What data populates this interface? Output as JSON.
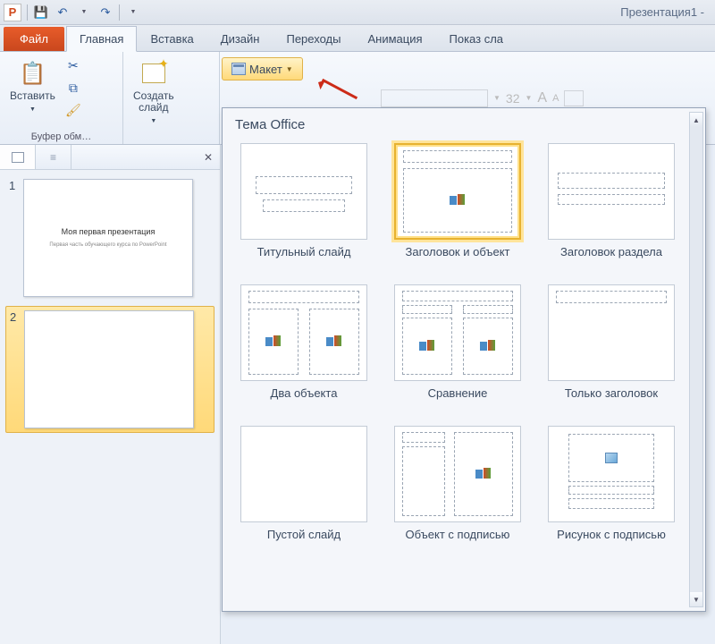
{
  "titlebar": {
    "app_letter": "P",
    "doc_title": "Презентация1 -"
  },
  "qat": {
    "save": "💾",
    "undo": "↶",
    "redo": "↷"
  },
  "tabs": {
    "file": "Файл",
    "home": "Главная",
    "insert": "Вставка",
    "design": "Дизайн",
    "transitions": "Переходы",
    "animation": "Анимация",
    "slideshow": "Показ сла"
  },
  "ribbon": {
    "clipboard": {
      "paste": "Вставить",
      "group": "Буфер обм…"
    },
    "slides": {
      "new_slide": "Создать\nслайд",
      "layout_btn": "Макет"
    },
    "disabled_fontsize": "32"
  },
  "gallery": {
    "title": "Тема Office",
    "items": [
      "Титульный слайд",
      "Заголовок и объект",
      "Заголовок раздела",
      "Два объекта",
      "Сравнение",
      "Только заголовок",
      "Пустой слайд",
      "Объект с подписью",
      "Рисунок с подписью"
    ]
  },
  "slidepanel": {
    "n1": "1",
    "n2": "2",
    "s1_title": "Моя первая презентация",
    "s1_sub": "Первая часть обучающего курса по PowerPoint"
  }
}
